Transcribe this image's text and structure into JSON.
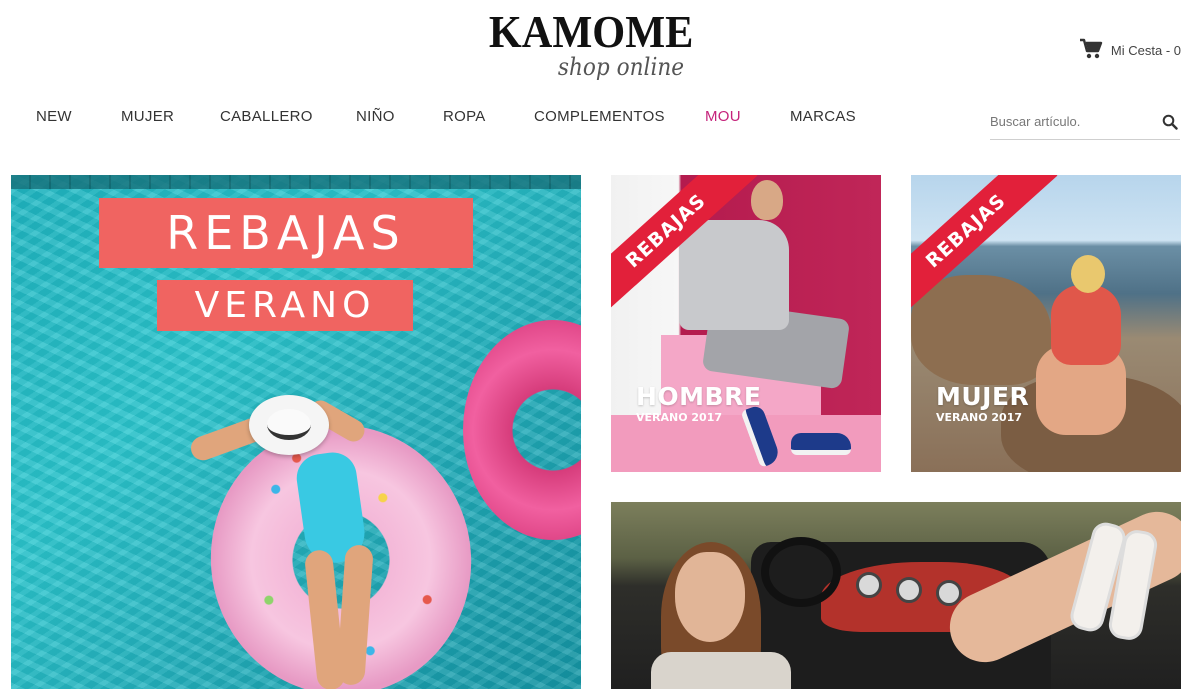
{
  "header": {
    "logo_main": "KAMOME",
    "logo_sub": "shop online",
    "cart_label": "Mi Cesta - 0"
  },
  "nav": {
    "items": [
      {
        "label": "NEW"
      },
      {
        "label": "MUJER"
      },
      {
        "label": "CABALLERO"
      },
      {
        "label": "NIÑO"
      },
      {
        "label": "ROPA"
      },
      {
        "label": "COMPLEMENTOS"
      },
      {
        "label": "MOU",
        "accent": true
      },
      {
        "label": "MARCAS"
      }
    ],
    "accent_color": "#c5237b"
  },
  "search": {
    "placeholder": "Buscar artículo."
  },
  "banners": {
    "main": {
      "title_line1": "REBAJAS",
      "title_line2": "VERANO"
    },
    "men": {
      "ribbon": "REBAJAS",
      "title": "HOMBRE",
      "subtitle": "VERANO 2017"
    },
    "women": {
      "ribbon": "REBAJAS",
      "title": "MUJER",
      "subtitle": "VERANO 2017"
    }
  },
  "colors": {
    "ribbon_red": "#e2203a",
    "title_coral": "#f06461"
  },
  "icons": {
    "cart": "shopping-cart-icon",
    "search": "magnifier-icon"
  }
}
